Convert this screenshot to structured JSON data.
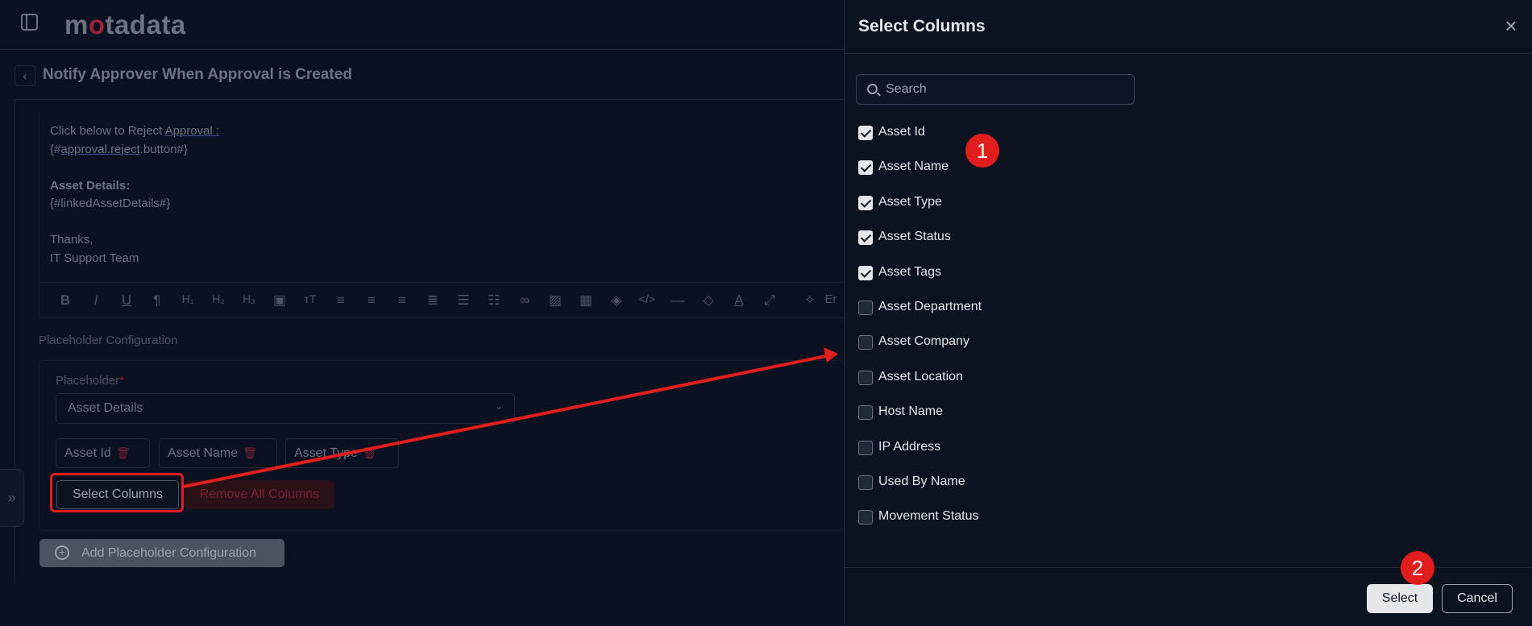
{
  "app": {
    "logo_text_pre": "m",
    "logo_dot": "o",
    "logo_text_post": "tadata"
  },
  "page": {
    "back_icon": "chevron-left-icon",
    "title": "Notify Approver When Approval is Created"
  },
  "editor": {
    "line1_prefix": "Click below to Reject ",
    "line1_link": "Approval :",
    "line2_prefix": "{#",
    "line2_link": "approval.reject",
    "line2_suffix": ".button#}",
    "heading": "Asset Details:",
    "placeholder_tag": "{#linkedAssetDetails#}",
    "closing": "Thanks,",
    "signature": "IT Support Team",
    "toolbar_overflow": "Er"
  },
  "placeholder_config": {
    "section_label": "Placeholder Configuration",
    "field_label": "Placeholder",
    "required_mark": "*",
    "selected_value": "Asset Details",
    "chips": [
      "Asset Id",
      "Asset Name",
      "Asset Type"
    ],
    "select_columns_label": "Select Columns",
    "remove_all_label": "Remove All Columns",
    "add_config_label": "Add Placeholder Configuration"
  },
  "drawer": {
    "title": "Select Columns",
    "search_placeholder": "Search",
    "columns": [
      {
        "label": "Asset Id",
        "checked": true
      },
      {
        "label": "Asset Name",
        "checked": true
      },
      {
        "label": "Asset Type",
        "checked": true
      },
      {
        "label": "Asset Status",
        "checked": true
      },
      {
        "label": "Asset Tags",
        "checked": true
      },
      {
        "label": "Asset Department",
        "checked": false
      },
      {
        "label": "Asset Company",
        "checked": false
      },
      {
        "label": "Asset Location",
        "checked": false
      },
      {
        "label": "Host Name",
        "checked": false
      },
      {
        "label": "IP Address",
        "checked": false
      },
      {
        "label": "Used By Name",
        "checked": false
      },
      {
        "label": "Movement Status",
        "checked": false
      }
    ],
    "select_label": "Select",
    "cancel_label": "Cancel"
  },
  "annotations": {
    "step1": "1",
    "step2": "2",
    "color": "#e11d1d"
  }
}
